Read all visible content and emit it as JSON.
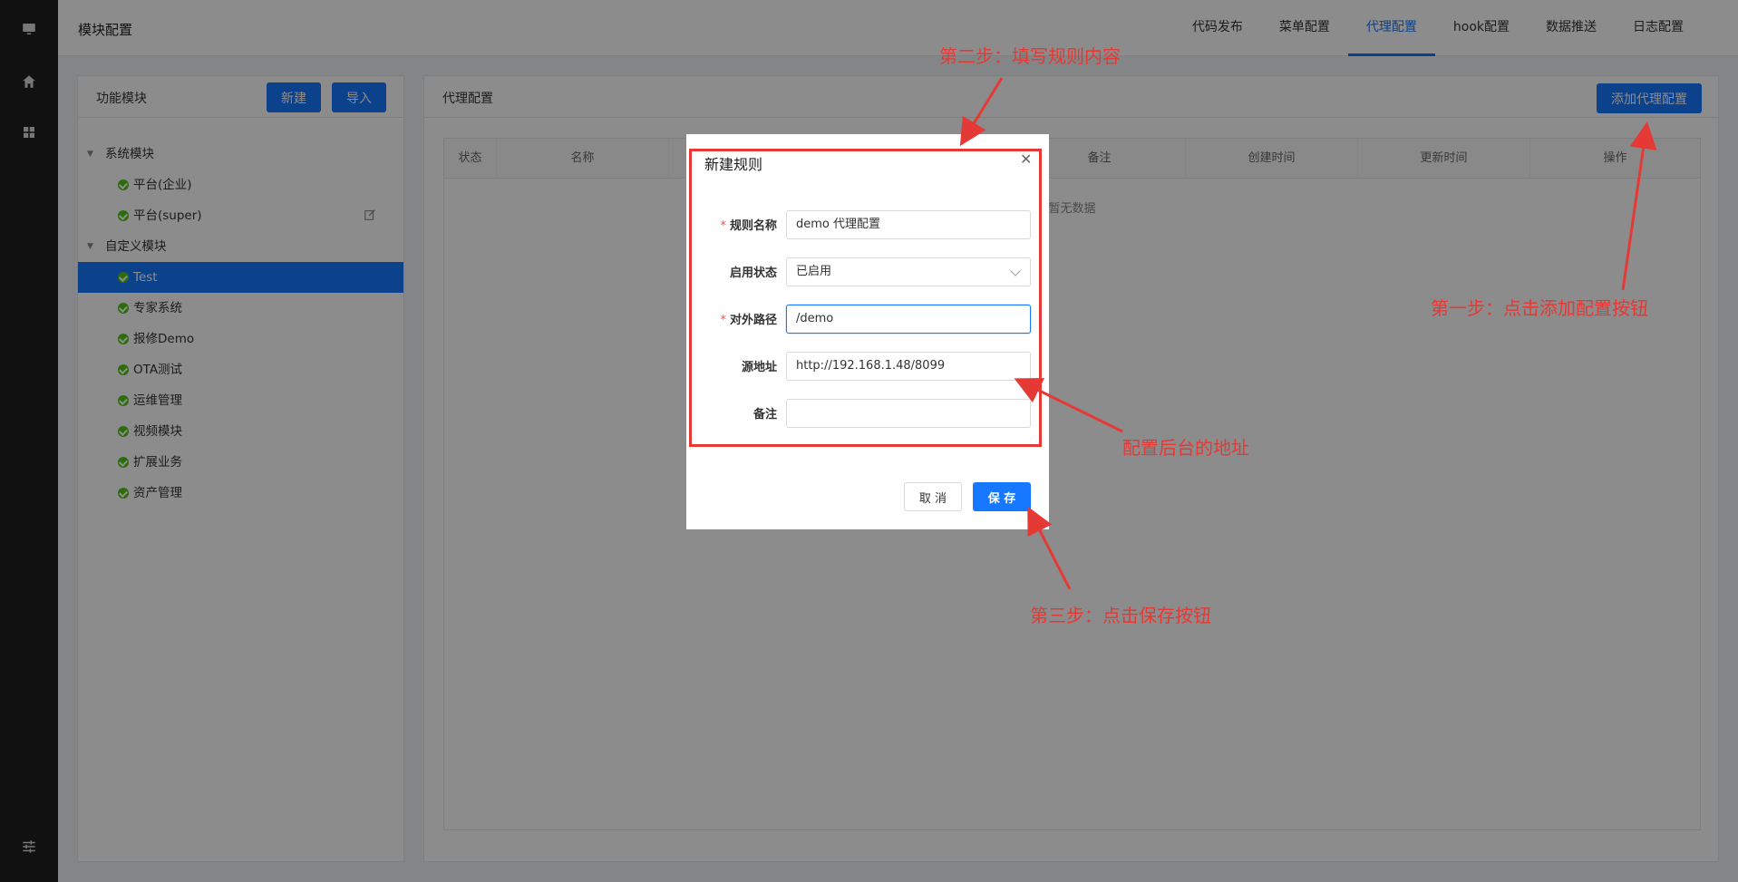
{
  "header": {
    "title": "模块配置",
    "tabs": [
      "代码发布",
      "菜单配置",
      "代理配置",
      "hook配置",
      "数据推送",
      "日志配置"
    ],
    "active_tab": "代理配置"
  },
  "left_panel": {
    "title": "功能模块",
    "new_button": "新建",
    "import_button": "导入",
    "groups": [
      {
        "label": "系统模块",
        "items": [
          "平台(企业)",
          "平台(super)"
        ]
      },
      {
        "label": "自定义模块",
        "items": [
          "Test",
          "专家系统",
          "报修Demo",
          "OTA测试",
          "运维管理",
          "视频模块",
          "扩展业务",
          "资产管理"
        ]
      }
    ],
    "selected_item": "Test"
  },
  "right_panel": {
    "title": "代理配置",
    "add_button": "添加代理配置",
    "columns": [
      "状态",
      "名称",
      "",
      "",
      "备注",
      "创建时间",
      "更新时间",
      "操作"
    ],
    "empty_text": "暂无数据"
  },
  "modal": {
    "title": "新建规则",
    "fields": [
      {
        "label": "规则名称",
        "required": true,
        "value": "demo 代理配置"
      },
      {
        "label": "启用状态",
        "required": false,
        "value": "已启用"
      },
      {
        "label": "对外路径",
        "required": true,
        "value": "/demo"
      },
      {
        "label": "源地址",
        "required": false,
        "value": "http://192.168.1.48/8099"
      },
      {
        "label": "备注",
        "required": false,
        "value": ""
      }
    ],
    "cancel_button": "取 消",
    "save_button": "保 存"
  },
  "annotations": {
    "step1": "第一步：点击添加配置按钮",
    "step2": "第二步：填写规则内容",
    "step3": "第三步：点击保存按钮",
    "source_note": "配置后台的地址"
  },
  "colors": {
    "primary": "#1677ff",
    "annotation": "#e53935",
    "rail": "#1f1f1f",
    "success": "#52c41a"
  }
}
